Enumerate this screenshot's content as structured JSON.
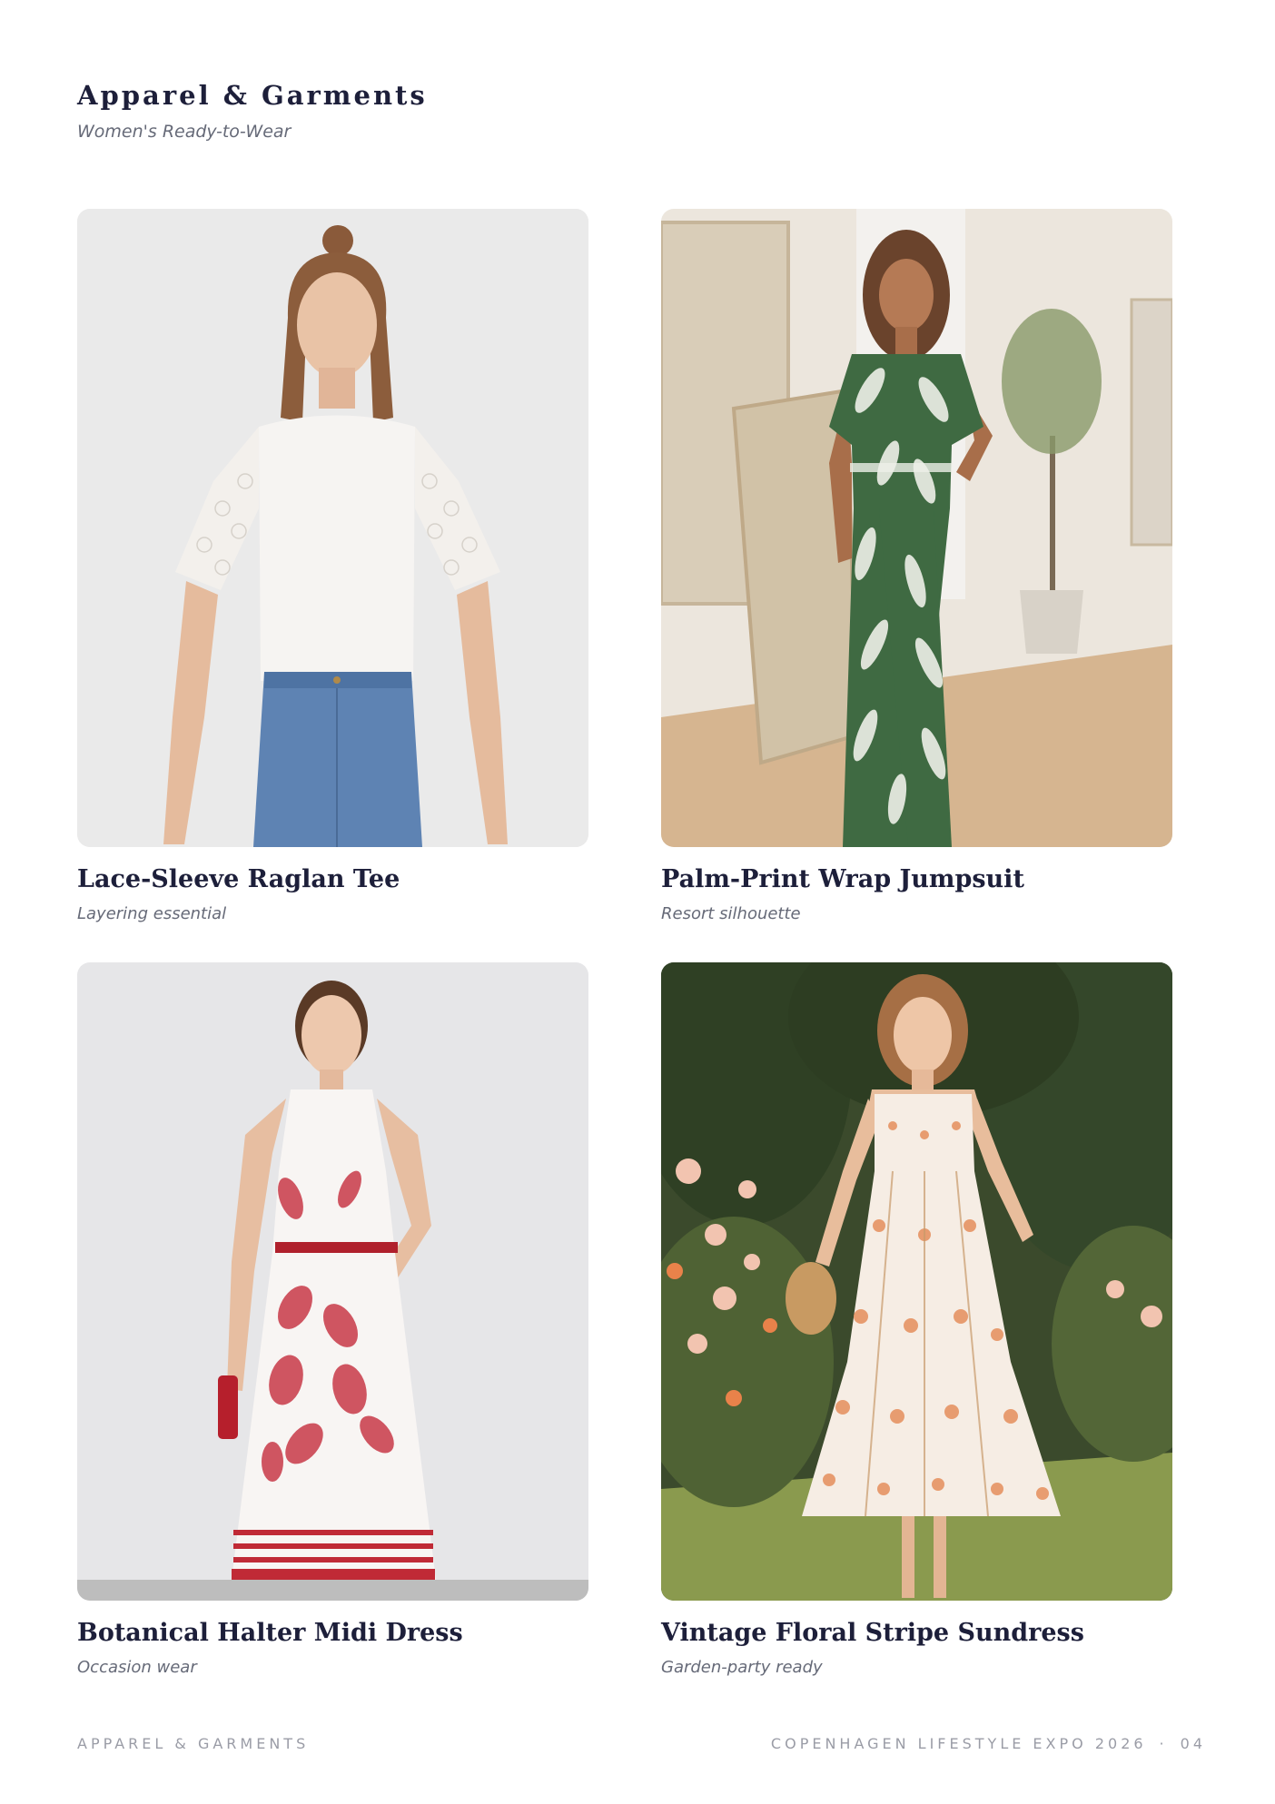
{
  "header": {
    "title": "Apparel & Garments",
    "subtitle": "Women's Ready-to-Wear"
  },
  "products": [
    {
      "name": "Lace-Sleeve Raglan Tee",
      "note": "Layering essential"
    },
    {
      "name": "Palm-Print Wrap Jumpsuit",
      "note": "Resort silhouette"
    },
    {
      "name": "Botanical Halter Midi Dress",
      "note": "Occasion wear"
    },
    {
      "name": "Vintage Floral Stripe Sundress",
      "note": "Garden-party ready"
    }
  ],
  "footer": {
    "left": "APPAREL & GARMENTS",
    "event": "COPENHAGEN LIFESTYLE EXPO 2026",
    "separator": "·",
    "page": "04"
  },
  "colors": {
    "title": "#1d1f3a",
    "subtle": "#666a78",
    "footer": "#9a9ca6"
  }
}
